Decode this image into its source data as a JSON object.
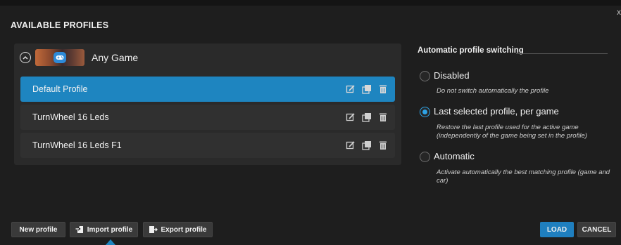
{
  "dialog": {
    "title": "AVAILABLE PROFILES",
    "close_label": "x"
  },
  "game": {
    "name": "Any Game",
    "thumbnail_icon": "gamepad-icon",
    "collapse_icon": "chevron-up-circle-icon"
  },
  "profiles": [
    {
      "label": "Default Profile",
      "selected": true
    },
    {
      "label": "TurnWheel 16 Leds",
      "selected": false
    },
    {
      "label": "TurnWheel 16 Leds F1",
      "selected": false
    }
  ],
  "row_actions": [
    "edit-icon",
    "duplicate-icon",
    "trash-icon"
  ],
  "switching": {
    "title": "Automatic profile switching",
    "options": [
      {
        "label": "Disabled",
        "description": "Do not switch automatically the profile",
        "checked": false
      },
      {
        "label": "Last selected profile, per game",
        "description": "Restore the last profile used for the active game (independently of the game being set in the profile)",
        "checked": true
      },
      {
        "label": "Automatic",
        "description": "Activate automatically the best matching profile (game and car)",
        "checked": false
      }
    ]
  },
  "footer": {
    "new_profile": "New profile",
    "import_profile": "Import profile",
    "export_profile": "Export profile",
    "load": "LOAD",
    "cancel": "CANCEL"
  },
  "colors": {
    "accent": "#1e85c0",
    "background": "#1e1e1e",
    "panel": "#2a2a2a"
  }
}
